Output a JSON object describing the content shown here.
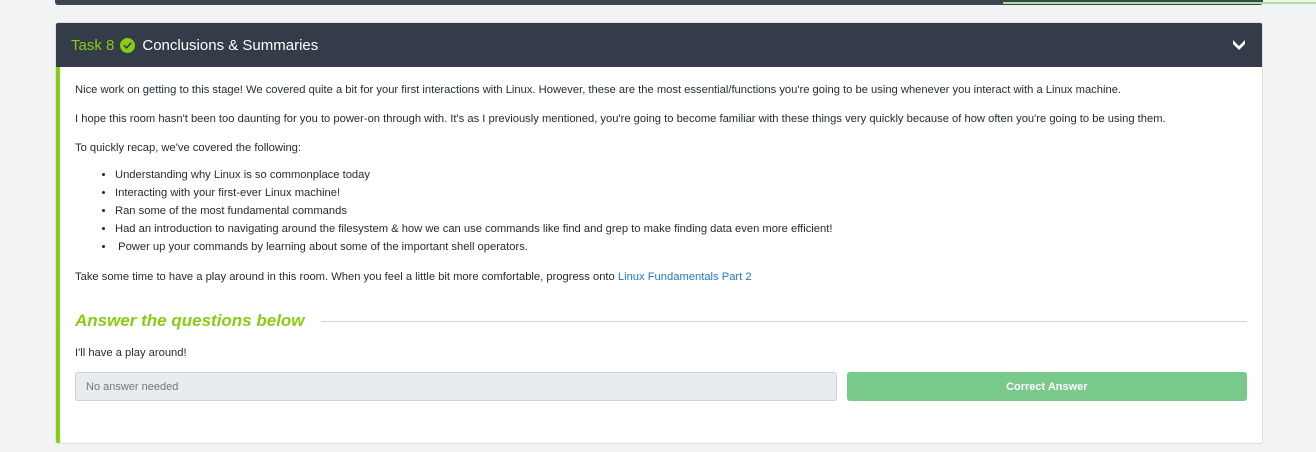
{
  "task": {
    "number_label": "Task 8",
    "title": "Conclusions & Summaries"
  },
  "body": {
    "paragraph1": "Nice work on getting to this stage! We covered quite a bit for your first interactions with Linux. However, these are the most essential/functions you're going to be using whenever you interact with a Linux machine.",
    "paragraph2": "I hope this room hasn't been too daunting for you to power-on through with. It's as I previously mentioned, you're going to become familiar with these things very quickly because of how often you're going to be using them.",
    "paragraph3": "To quickly recap, we've covered the following:",
    "bullets": [
      "Understanding why Linux is so commonplace today",
      "Interacting with your first-ever Linux machine!",
      "Ran some of the most fundamental commands",
      "Had an introduction to navigating around the filesystem & how we can use commands like find and grep to make finding data even more efficient!",
      " Power up your commands by learning about some of the important shell operators."
    ],
    "closing_text": "Take some time to have a play around in this room. When you feel a little bit more comfortable, progress onto ",
    "closing_link": "Linux Fundamentals Part 2"
  },
  "questions": {
    "section_title": "Answer the questions below",
    "question1": "I'll have a play around!",
    "answer_placeholder": "No answer needed",
    "submit_label": "Correct Answer"
  },
  "colors": {
    "accent": "#88cc14",
    "header_bg": "#343c4a",
    "link": "#1e78c8",
    "button": "#79c98a"
  }
}
